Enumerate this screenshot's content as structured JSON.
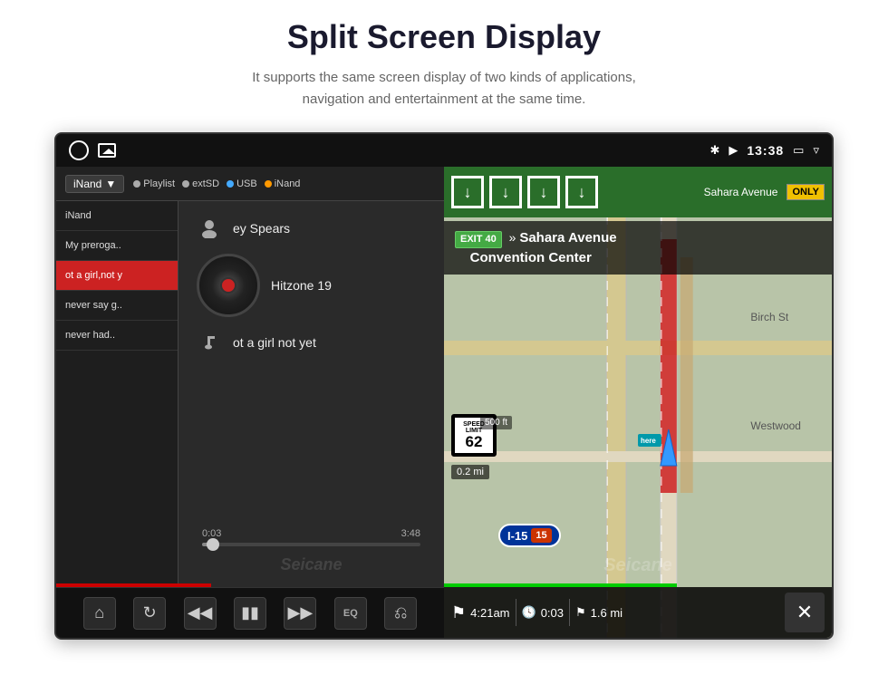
{
  "page": {
    "title": "Split Screen Display",
    "subtitle": "It supports the same screen display of two kinds of applications,\nnavigation and entertainment at the same time."
  },
  "statusBar": {
    "time": "13:38",
    "icons": [
      "bluetooth",
      "location",
      "window",
      "back"
    ]
  },
  "musicPanel": {
    "sourceDropdown": "iNand",
    "sourceTabs": [
      "Playlist",
      "extSD",
      "USB",
      "iNand"
    ],
    "playlist": [
      {
        "title": "iNand",
        "active": false
      },
      {
        "title": "My preroga..",
        "active": false
      },
      {
        "title": "ot a girl,not y",
        "active": true
      },
      {
        "title": "never say g..",
        "active": false
      },
      {
        "title": "never had..",
        "active": false
      }
    ],
    "nowPlaying": {
      "artist": "ey Spears",
      "album": "Hitzone 19",
      "track": "ot a girl not yet"
    },
    "progress": {
      "current": "0:03",
      "total": "3:48",
      "percent": 5
    },
    "controls": [
      "home",
      "repeat",
      "prev",
      "pause",
      "next",
      "eq",
      "back"
    ],
    "watermark": "Seicane"
  },
  "navPanel": {
    "topStrip": {
      "arrows": [
        "down",
        "down",
        "down",
        "down"
      ],
      "onlyLabel": "ONLY"
    },
    "exitBanner": {
      "exitNum": "EXIT 40",
      "destination": "Sahara Avenue\nConvention Center"
    },
    "speedLimit": "62",
    "highway": "I-15",
    "highwayNum": "15",
    "distance": "0.2 mi",
    "footDistance": "500 ft",
    "eta": {
      "time": "4:21am",
      "duration": "0:03",
      "distance": "1.6 mi"
    },
    "roadLabels": [
      "Birch St",
      "Westwood"
    ],
    "watermark": "Seicane"
  }
}
